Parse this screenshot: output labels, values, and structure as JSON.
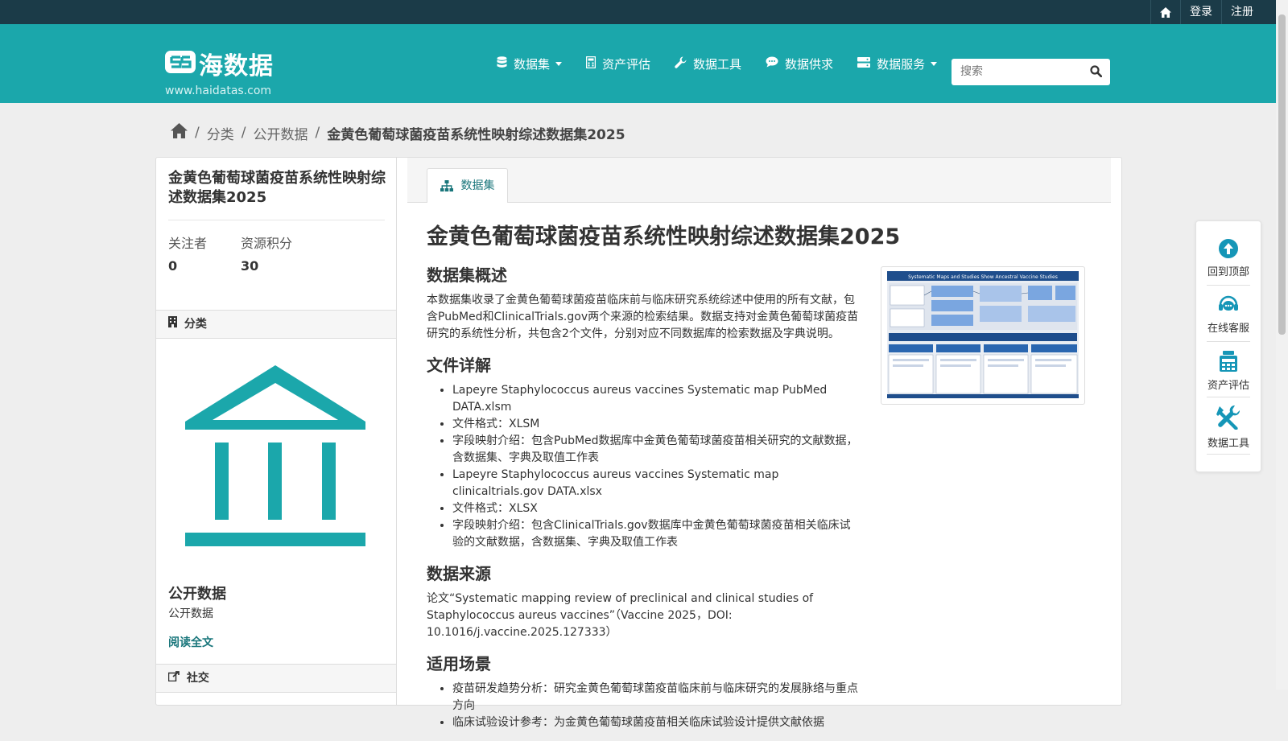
{
  "topbar": {
    "home_icon": "home-icon",
    "login": "登录",
    "register": "注册"
  },
  "brand": {
    "logo_text": "海数据",
    "site_url": "www.haidatas.com",
    "colors": {
      "masthead": "#1ba7ab",
      "topbar": "#1b3b48",
      "accent": "#19767b"
    }
  },
  "nav": {
    "items": [
      {
        "label": "数据集",
        "icon": "database-icon",
        "has_dropdown": true
      },
      {
        "label": "资产评估",
        "icon": "calculator-icon",
        "has_dropdown": false
      },
      {
        "label": "数据工具",
        "icon": "wrench-icon",
        "has_dropdown": false
      },
      {
        "label": "数据供求",
        "icon": "chat-icon",
        "has_dropdown": false
      },
      {
        "label": "数据服务",
        "icon": "server-icon",
        "has_dropdown": true
      }
    ]
  },
  "search": {
    "placeholder": "搜索",
    "value": ""
  },
  "breadcrumb": {
    "items": [
      "分类",
      "公开数据"
    ],
    "current": "金黄色葡萄球菌疫苗系统性映射综述数据集2025"
  },
  "sidebar": {
    "title": "金黄色葡萄球菌疫苗系统性映射综述数据集2025",
    "stats": [
      {
        "label": "关注者",
        "value": "0"
      },
      {
        "label": "资源积分",
        "value": "30"
      }
    ],
    "category_heading": "分类",
    "organization": {
      "name": "公开数据",
      "description": "公开数据",
      "read_more": "阅读全文"
    },
    "social_heading": "社交"
  },
  "content": {
    "tab_label": "数据集",
    "title": "金黄色葡萄球菌疫苗系统性映射综述数据集2025",
    "sections": {
      "overview_heading": "数据集概述",
      "overview_text": "本数据集收录了金黄色葡萄球菌疫苗临床前与临床研究系统综述中使用的所有文献，包含PubMed和ClinicalTrials.gov两个来源的检索结果。数据支持对金黄色葡萄球菌疫苗研究的系统性分析，共包含2个文件，分别对应不同数据库的检索数据及字典说明。",
      "files_heading": "文件详解",
      "files": [
        "Lapeyre Staphylococcus aureus vaccines Systematic map PubMed DATA.xlsm",
        "文件格式：XLSM",
        "字段映射介绍：包含PubMed数据库中金黄色葡萄球菌疫苗相关研究的文献数据，含数据集、字典及取值工作表",
        "Lapeyre Staphylococcus aureus vaccines Systematic map clinicaltrials.gov DATA.xlsx",
        "文件格式：XLSX",
        "字段映射介绍：包含ClinicalTrials.gov数据库中金黄色葡萄球菌疫苗相关临床试验的文献数据，含数据集、字典及取值工作表"
      ],
      "source_heading": "数据来源",
      "source_text": "论文“Systematic mapping review of preclinical and clinical studies of Staphylococcus aureus vaccines”（Vaccine 2025，DOI: 10.1016/j.vaccine.2025.127333）",
      "usage_heading": "适用场景",
      "usage": [
        "疫苗研发趋势分析：研究金黄色葡萄球菌疫苗临床前与临床研究的发展脉络与重点方向",
        "临床试验设计参考：为金黄色葡萄球菌疫苗相关临床试验设计提供文献依据"
      ]
    },
    "preview_image_title": "Systematic Maps and Studies Show Ancestral Vaccine Studies"
  },
  "float_bar": {
    "items": [
      {
        "label": "回到顶部",
        "icon": "arrow-up-circle-icon"
      },
      {
        "label": "在线客服",
        "icon": "headset-icon"
      },
      {
        "label": "资产评估",
        "icon": "assessment-icon"
      },
      {
        "label": "数据工具",
        "icon": "tools-icon"
      }
    ]
  }
}
